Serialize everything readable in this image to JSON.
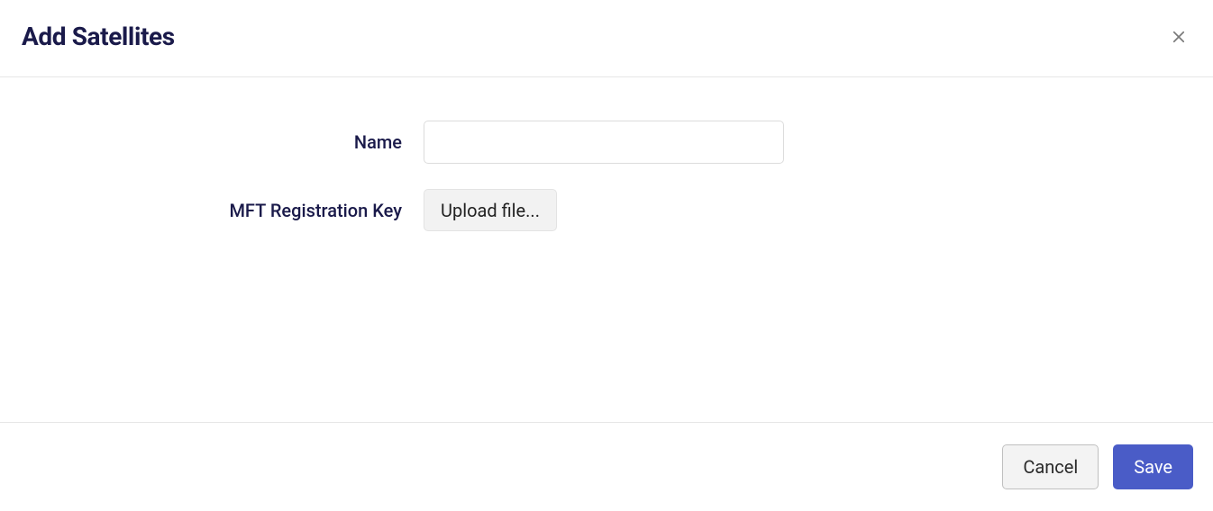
{
  "dialog": {
    "title": "Add Satellites"
  },
  "form": {
    "name": {
      "label": "Name",
      "value": ""
    },
    "mft_key": {
      "label": "MFT Registration Key",
      "upload_button": "Upload file..."
    }
  },
  "footer": {
    "cancel": "Cancel",
    "save": "Save"
  }
}
